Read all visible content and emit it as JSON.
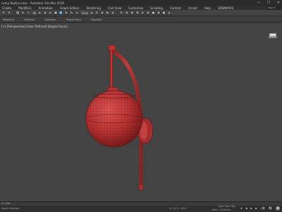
{
  "window": {
    "title": "Lamp Replica.max - Autodesk 3ds Max 2019",
    "controls": [
      "—",
      "☐",
      "✕"
    ]
  },
  "menubar": {
    "items": [
      "Create",
      "Modifiers",
      "Animation",
      "Graph Editors",
      "Rendering",
      "Civil View",
      "Customize",
      "Scripting",
      "Content",
      "Arnold",
      "Help"
    ],
    "workspace": "3DSMAX03",
    "search_label": "Signin"
  },
  "toolbar": {
    "selection_set_label": "All",
    "view_label": "View"
  },
  "ribbon": {
    "tabs": [
      "Modeling",
      "Freeform",
      "Selection",
      "Object Paint",
      "Populate"
    ]
  },
  "viewport": {
    "label": "[+] [Perspective] [User Defined] [Edged Faces]",
    "model_color": "#c23b3b",
    "wire_color": "#5a1212"
  },
  "statusbar": {
    "frame_counter": "0 / 100",
    "coords": "X: 1.0  Y: -50.0",
    "grid": "Grid = 10.0mm",
    "add_time_tag": "Add Time Tag",
    "selection_text": "None Selected"
  }
}
